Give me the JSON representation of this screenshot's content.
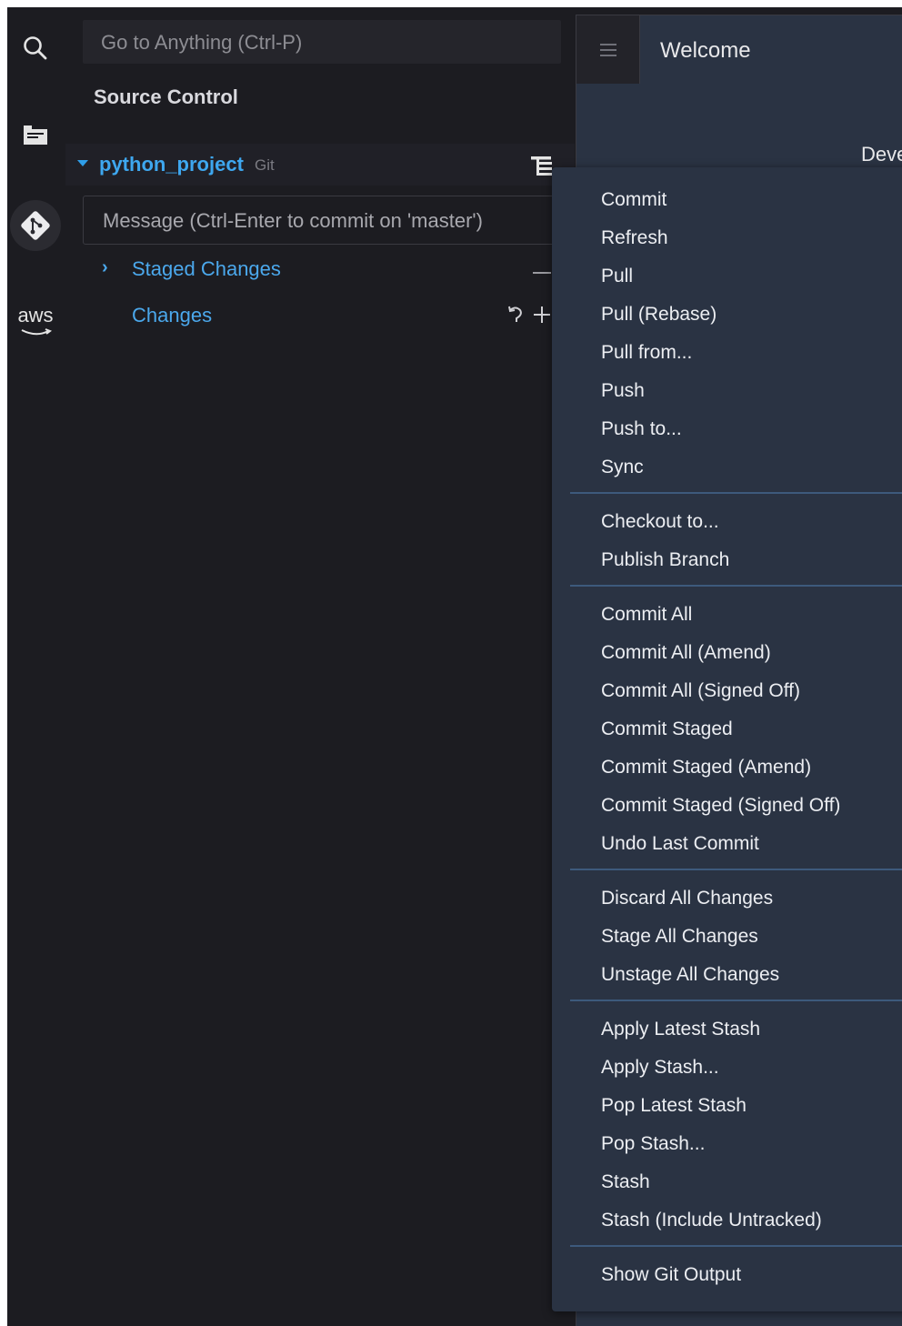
{
  "sidebar": {
    "goto_placeholder": "Go to Anything (Ctrl-P)",
    "section_title": "Source Control",
    "activity_icons": [
      "search-icon",
      "explorer-icon",
      "git-icon",
      "aws-icon"
    ],
    "aws_label": "aws",
    "repo": {
      "name": "python_project",
      "tag": "Git"
    },
    "commit_message_placeholder": "Message (Ctrl-Enter to commit on 'master')",
    "groups": {
      "staged": "Staged Changes",
      "changes": "Changes"
    }
  },
  "editor": {
    "tab_title": "Welcome",
    "body_text_partial": "Deve"
  },
  "context_menu": {
    "groups": [
      [
        "Commit",
        "Refresh",
        "Pull",
        "Pull (Rebase)",
        "Pull from...",
        "Push",
        "Push to...",
        "Sync"
      ],
      [
        "Checkout to...",
        "Publish Branch"
      ],
      [
        "Commit All",
        "Commit All (Amend)",
        "Commit All (Signed Off)",
        "Commit Staged",
        "Commit Staged (Amend)",
        "Commit Staged (Signed Off)",
        "Undo Last Commit"
      ],
      [
        "Discard All Changes",
        "Stage All Changes",
        "Unstage All Changes"
      ],
      [
        "Apply Latest Stash",
        "Apply Stash...",
        "Pop Latest Stash",
        "Pop Stash...",
        "Stash",
        "Stash (Include Untracked)"
      ],
      [
        "Show Git Output"
      ]
    ]
  },
  "colors": {
    "background": "#1c1c21",
    "accent": "#3ea7ef",
    "menu_background": "#2a3343",
    "separator": "#3d5a7c"
  }
}
